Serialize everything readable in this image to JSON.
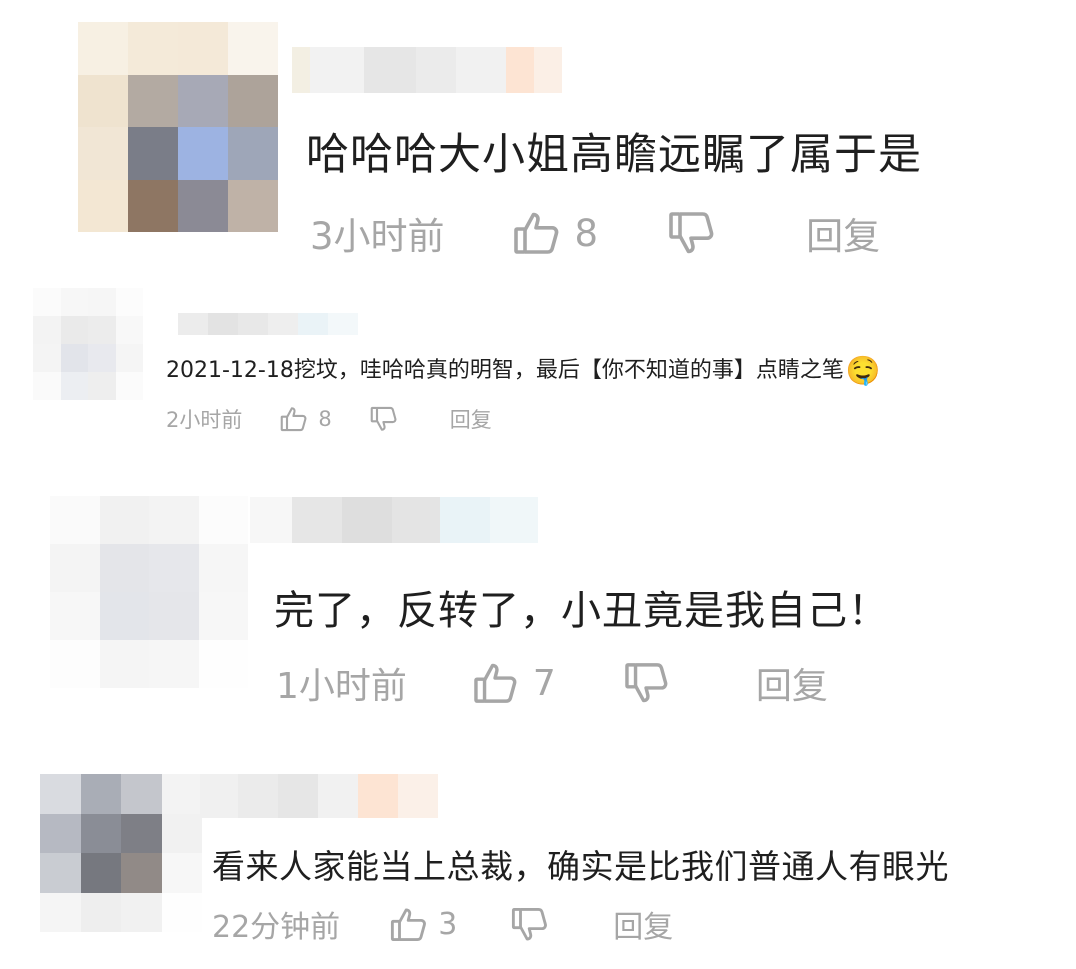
{
  "comments": [
    {
      "text": "哈哈哈大小姐高瞻远瞩了属于是",
      "time": "3小时前",
      "likes": "8",
      "reply_label": "回复",
      "icons": {
        "like": "thumbs-up-icon",
        "dislike": "thumbs-down-icon"
      }
    },
    {
      "text": "2021-12-18挖坟，哇哈哈真的明智，最后【你不知道的事】点睛之笔",
      "emoji": "🤤",
      "time": "2小时前",
      "likes": "8",
      "reply_label": "回复",
      "icons": {
        "like": "thumbs-up-icon",
        "dislike": "thumbs-down-icon",
        "emoji": "drooling-face-emoji"
      }
    },
    {
      "text": "完了，反转了，小丑竟是我自己！",
      "time": "1小时前",
      "likes": "7",
      "reply_label": "回复",
      "icons": {
        "like": "thumbs-up-icon",
        "dislike": "thumbs-down-icon"
      }
    },
    {
      "text": "看来人家能当上总裁，确实是比我们普通人有眼光",
      "time": "22分钟前",
      "likes": "3",
      "reply_label": "回复",
      "icons": {
        "like": "thumbs-up-icon",
        "dislike": "thumbs-down-icon"
      }
    }
  ],
  "colors": {
    "text": "#1f1f1f",
    "meta": "#a6a6a6",
    "background": "#ffffff"
  }
}
